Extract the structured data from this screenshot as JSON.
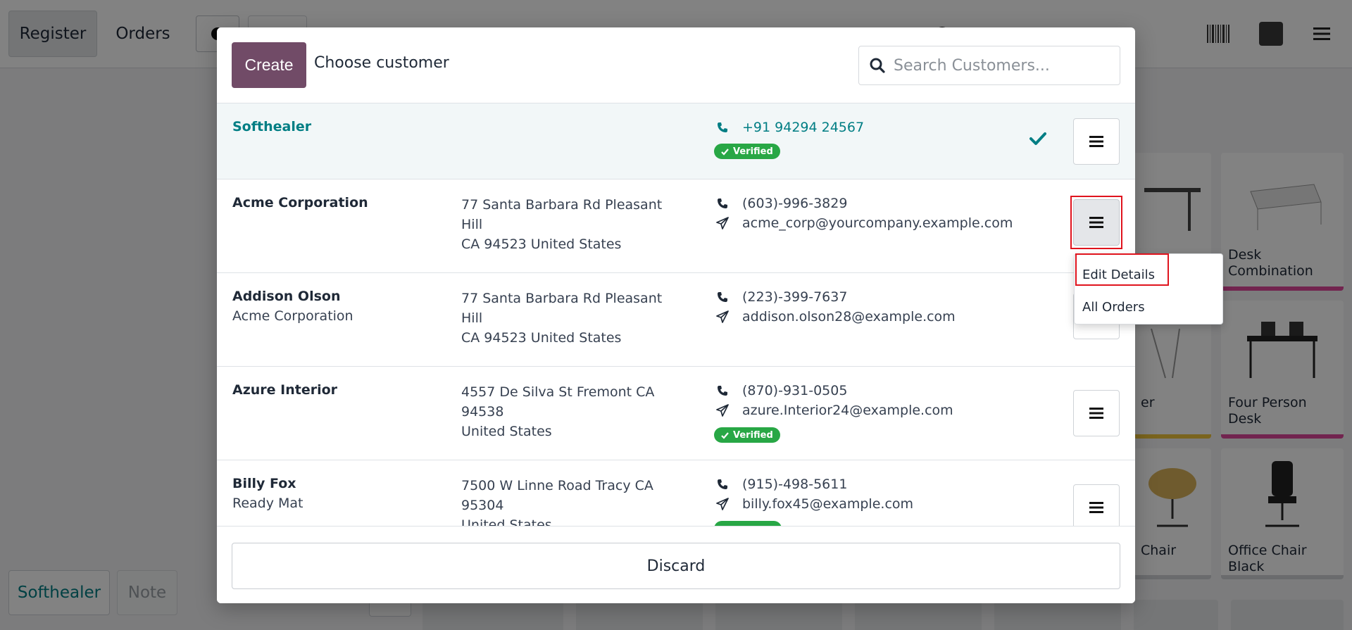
{
  "topbar": {
    "register": "Register",
    "orders": "Orders"
  },
  "footer_left": {
    "customer": "Softhealer",
    "note": "Note"
  },
  "products": [
    {
      "name": "Desk Combination",
      "color": "#e0489c"
    },
    {
      "name": "er",
      "color": "#f0c43c"
    },
    {
      "name": "Four Person Desk",
      "color": "#e0489c"
    },
    {
      "name": "Chair",
      "color": "#d0d3d6"
    },
    {
      "name": "Office Chair Black",
      "color": "#d0d3d6"
    }
  ],
  "modal": {
    "create_label": "Create",
    "title": "Choose customer",
    "search_placeholder": "Search Customers...",
    "discard_label": "Discard",
    "customers": [
      {
        "name": "Softhealer",
        "sub": "",
        "addr1": "",
        "addr2": "",
        "phone": "+91 94294 24567",
        "email": "",
        "verified": "Verified",
        "selected": true
      },
      {
        "name": "Acme Corporation",
        "sub": "",
        "addr1": "77 Santa Barbara Rd Pleasant Hill",
        "addr2": "CA 94523 United States",
        "phone": "(603)-996-3829",
        "email": "acme_corp@yourcompany.example.com",
        "verified": ""
      },
      {
        "name": "Addison Olson",
        "sub": "Acme Corporation",
        "addr1": "77 Santa Barbara Rd Pleasant Hill",
        "addr2": "CA 94523 United States",
        "phone": "(223)-399-7637",
        "email": "addison.olson28@example.com",
        "verified": ""
      },
      {
        "name": "Azure Interior",
        "sub": "",
        "addr1": "4557 De Silva St Fremont CA 94538",
        "addr2": "United States",
        "phone": "(870)-931-0505",
        "email": "azure.Interior24@example.com",
        "verified": "Verified"
      },
      {
        "name": "Billy Fox",
        "sub": "Ready Mat",
        "addr1": "7500 W Linne Road Tracy CA 95304",
        "addr2": "United States",
        "phone": "(915)-498-5611",
        "email": "billy.fox45@example.com",
        "verified": ""
      }
    ]
  },
  "dropdown": {
    "items": [
      "Edit Details",
      "All Orders"
    ]
  },
  "icons": {
    "search": "search-icon",
    "phone": "phone-icon",
    "email": "paper-plane-icon",
    "menu": "hamburger-icon",
    "check": "check-icon"
  },
  "colors": {
    "primary": "#714b67",
    "teal": "#017e84",
    "verified": "#28a745",
    "highlight": "#e0141e"
  }
}
